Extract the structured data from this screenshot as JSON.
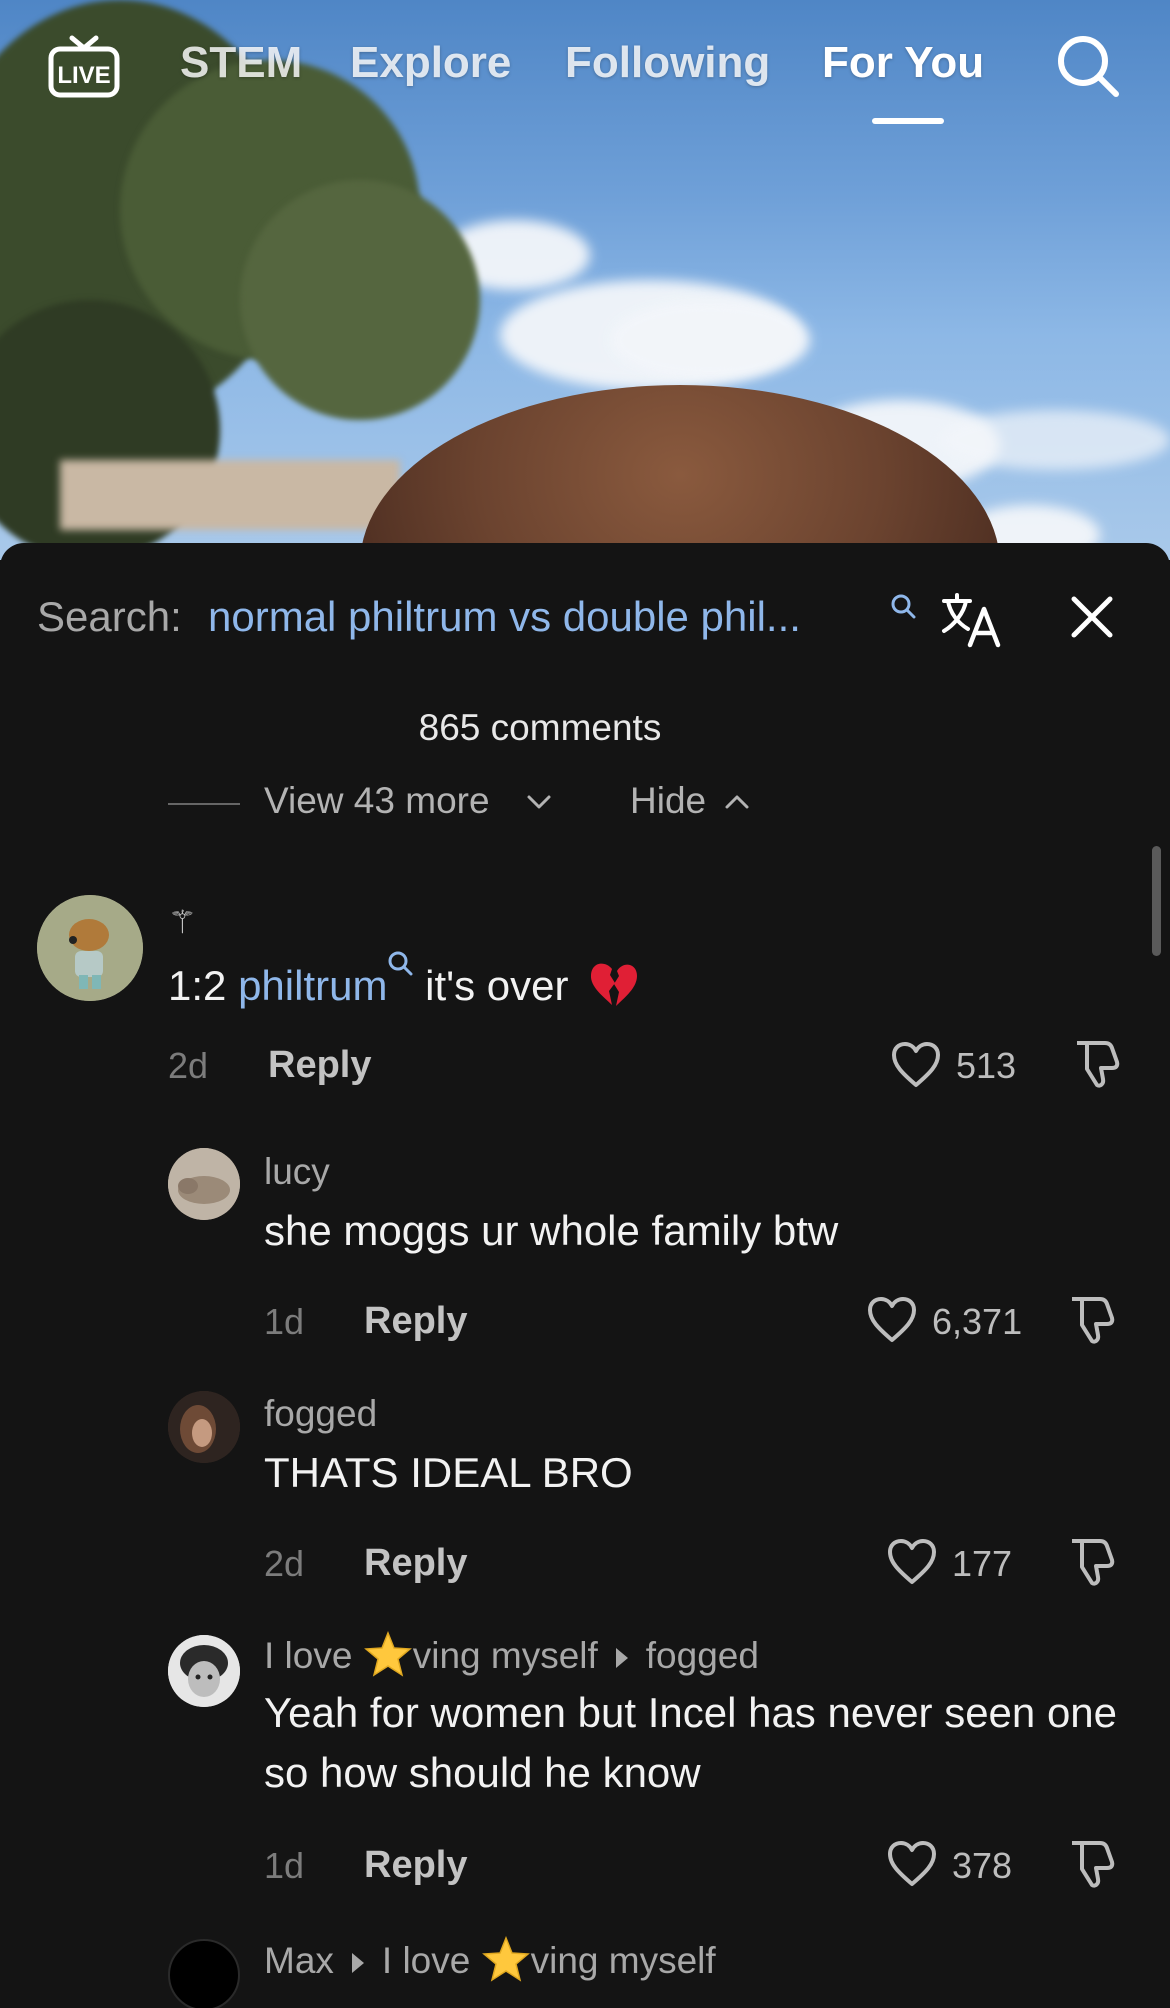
{
  "topnav": {
    "tabs": [
      {
        "label": "STEM"
      },
      {
        "label": "Explore"
      },
      {
        "label": "Following"
      },
      {
        "label": "For You",
        "active": true
      }
    ],
    "live_icon": "live-tv-icon",
    "search_icon": "search-icon"
  },
  "search": {
    "prefix": "Search:",
    "query": "normal philtrum vs double phil...",
    "translate_icon": "translate-icon",
    "close_icon": "close-icon"
  },
  "comments_count": "865 comments",
  "thread_controls": {
    "view_more": "View 43 more",
    "hide": "Hide"
  },
  "comments": [
    {
      "username_symbol": "⚚",
      "text_prefix": "1:2 ",
      "text_link": "philtrum",
      "text_suffix": " it's over",
      "emoji": "broken-heart",
      "date": "2d",
      "reply": "Reply",
      "likes": "513",
      "avatar": "capybara-avatar"
    },
    {
      "username": "lucy",
      "text": "she moggs ur whole family btw",
      "date": "1d",
      "reply": "Reply",
      "likes": "6,371"
    },
    {
      "username": "fogged",
      "text": "THATS IDEAL BRO",
      "date": "2d",
      "reply": "Reply",
      "likes": "177"
    },
    {
      "username_pre": "I love ",
      "username_post": "ving myself",
      "reply_to": "fogged",
      "text": "Yeah for women but Incel has never seen one so how should he know",
      "date": "1d",
      "reply": "Reply",
      "likes": "378"
    },
    {
      "username": "Max",
      "reply_to_pre": "I love ",
      "reply_to_post": "ving myself"
    }
  ],
  "colors": {
    "sheet_bg": "#141414",
    "link_blue": "#8fb7ea",
    "muted_text": "#a8a8a8"
  }
}
